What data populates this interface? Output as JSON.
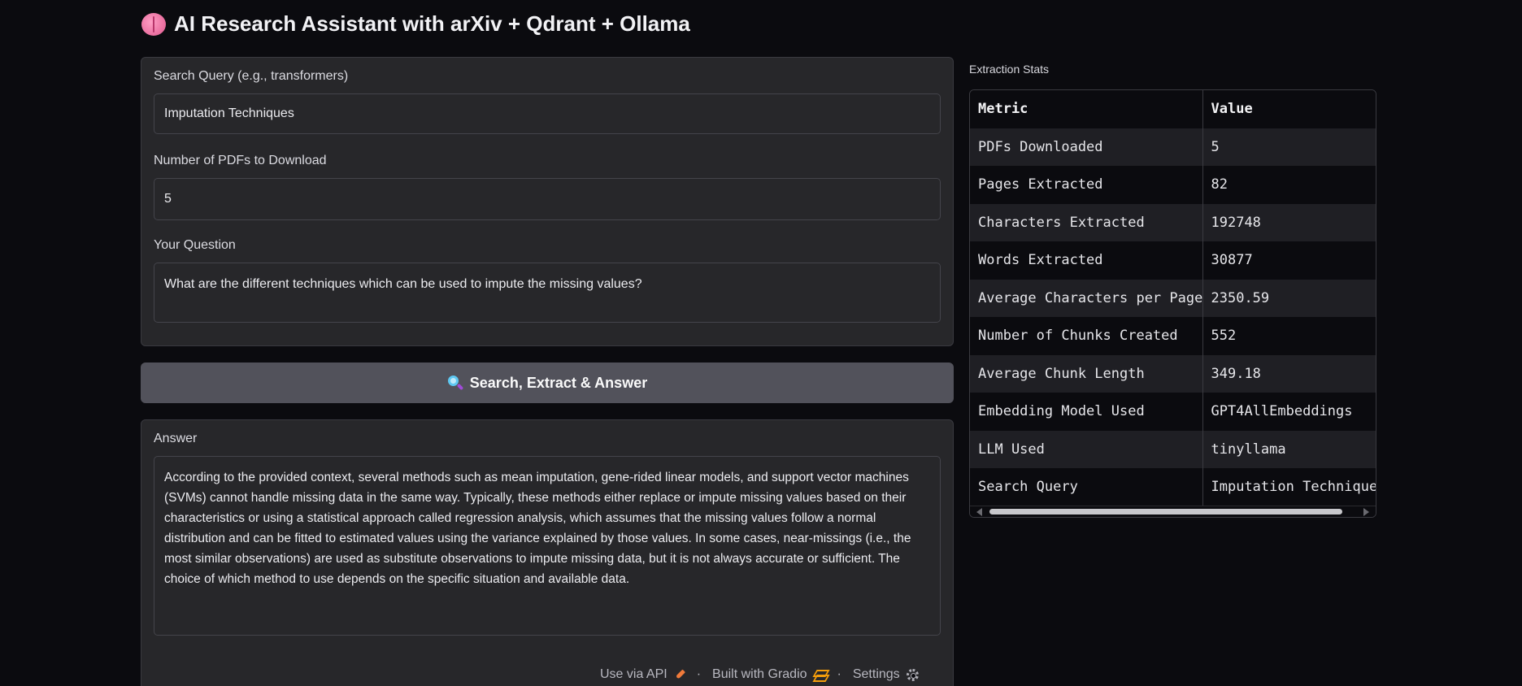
{
  "header": {
    "title": "AI Research Assistant with arXiv + Qdrant + Ollama",
    "icon": "brain-icon"
  },
  "search_query": {
    "label": "Search Query (e.g., transformers)",
    "value": "Imputation Techniques"
  },
  "num_pdfs": {
    "label": "Number of PDFs to Download",
    "value": "5"
  },
  "question": {
    "label": "Your Question",
    "value": "What are the different techniques which can be used to impute the missing values?"
  },
  "action_button": {
    "icon": "magnifier-icon",
    "label": "Search, Extract & Answer"
  },
  "answer": {
    "label": "Answer",
    "value": "According to the provided context, several methods such as mean imputation, gene-rided linear models, and support vector machines (SVMs) cannot handle missing data in the same way. Typically, these methods either replace or impute missing values based on their characteristics or using a statistical approach called regression analysis, which assumes that the missing values follow a normal distribution and can be fitted to estimated values using the variance explained by those values. In some cases, near-missings (i.e., the most similar observations) are used as substitute observations to impute missing data, but it is not always accurate or sufficient. The choice of which method to use depends on the specific situation and available data."
  },
  "stats": {
    "label": "Extraction Stats",
    "headers": [
      "Metric",
      "Value"
    ],
    "rows": [
      [
        "PDFs Downloaded",
        "5"
      ],
      [
        "Pages Extracted",
        "82"
      ],
      [
        "Characters Extracted",
        "192748"
      ],
      [
        "Words Extracted",
        "30877"
      ],
      [
        "Average Characters per Page",
        "2350.59"
      ],
      [
        "Number of Chunks Created",
        "552"
      ],
      [
        "Average Chunk Length",
        "349.18"
      ],
      [
        "Embedding Model Used",
        "GPT4AllEmbeddings"
      ],
      [
        "LLM Used",
        "tinyllama"
      ],
      [
        "Search Query",
        "Imputation Techniques"
      ]
    ]
  },
  "footer": {
    "api_label": "Use via API",
    "built_label": "Built with Gradio",
    "settings_label": "Settings",
    "separator": "·"
  },
  "colors": {
    "background": "#0b0b0f",
    "panel": "#27272a",
    "button": "#52525b"
  }
}
